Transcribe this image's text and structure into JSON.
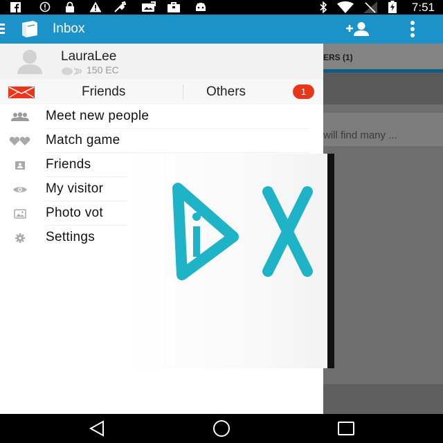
{
  "status_bar": {
    "time": "7:51",
    "icons": [
      "facebook-icon",
      "alert-circle-icon",
      "lock-icon",
      "warning-icon",
      "satellite-icon",
      "photo-icon",
      "bag-icon",
      "android-icon",
      "bluetooth-icon",
      "wifi-icon",
      "no-signal-icon",
      "battery-charging-icon"
    ]
  },
  "app_bar": {
    "title": "Inbox",
    "icons": [
      "menu-icon",
      "app-logo-icon",
      "add-person-icon",
      "overflow-menu-icon"
    ],
    "color": "#1b92c8"
  },
  "drawer": {
    "profile": {
      "name": "LauraLee",
      "coins": "150 EC"
    },
    "tabs": {
      "friends": "Friends",
      "others": "Others",
      "others_badge": "1",
      "badge_color": "#e8361b"
    },
    "menu": [
      {
        "label": "Meet new people",
        "icon": "people-icon"
      },
      {
        "label": "Match game",
        "icon": "hearts-icon"
      },
      {
        "label": "Friends",
        "icon": "contact-card-icon"
      },
      {
        "label": "My visitor",
        "icon": "eye-icon"
      },
      {
        "label": "Photo vot",
        "icon": "photo-icon"
      },
      {
        "label": "Settings",
        "icon": "gear-icon"
      }
    ]
  },
  "background_screen": {
    "tab_label": "ERS (1)",
    "message_preview": "will find many ..."
  },
  "ad_overlay": {
    "logo": "dx-logo",
    "accent_color": "#1fb3c7"
  },
  "nav_bar": {
    "icons": [
      "back-icon",
      "home-icon",
      "recents-icon"
    ]
  }
}
